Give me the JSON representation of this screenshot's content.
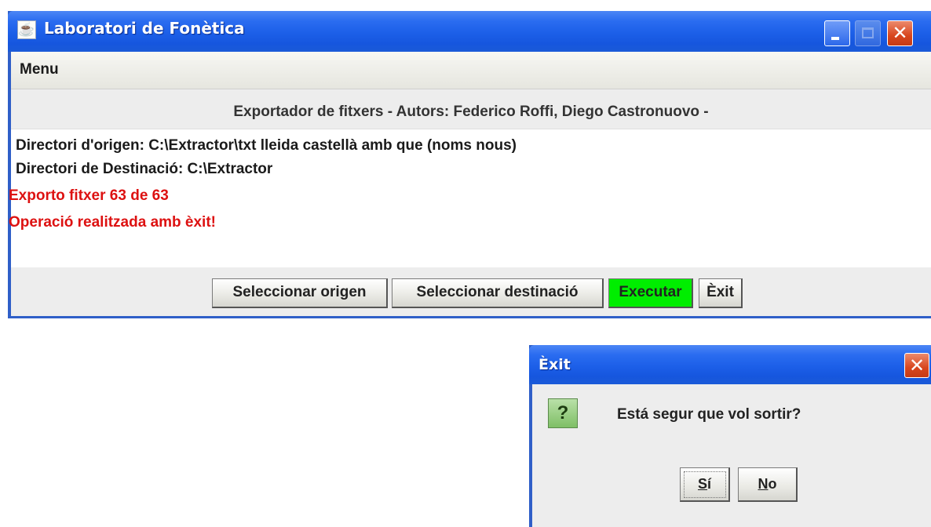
{
  "main_window": {
    "title": "Laboratori de Fonètica",
    "menu": {
      "items": [
        "Menu"
      ]
    },
    "header_label": "Exportador de fitxers - Autors: Federico Roffi, Diego Castronuovo -",
    "log": {
      "origin_line": "Directori d'origen: C:\\Extractor\\txt lleida castellà amb que (noms nous)",
      "destination_line": "Directori de Destinació: C:\\Extractor",
      "progress_line": "Exporto fitxer 63 de 63",
      "result_line": "Operació realitzada amb èxit!"
    },
    "buttons": {
      "select_origin": "Seleccionar origen",
      "select_destination": "Seleccionar destinació",
      "execute": "Executar",
      "exit": "Èxit"
    }
  },
  "dialog": {
    "title": "Èxit",
    "message": "Está segur que vol sortir?",
    "buttons": {
      "yes_mnemonic": "S",
      "yes_rest": "í",
      "no_mnemonic": "N",
      "no_rest": "o"
    }
  },
  "colors": {
    "titlebar_blue": "#1c5fe8",
    "execute_green": "#00ee00",
    "status_red": "#dd1111",
    "close_red": "#d8461e"
  }
}
